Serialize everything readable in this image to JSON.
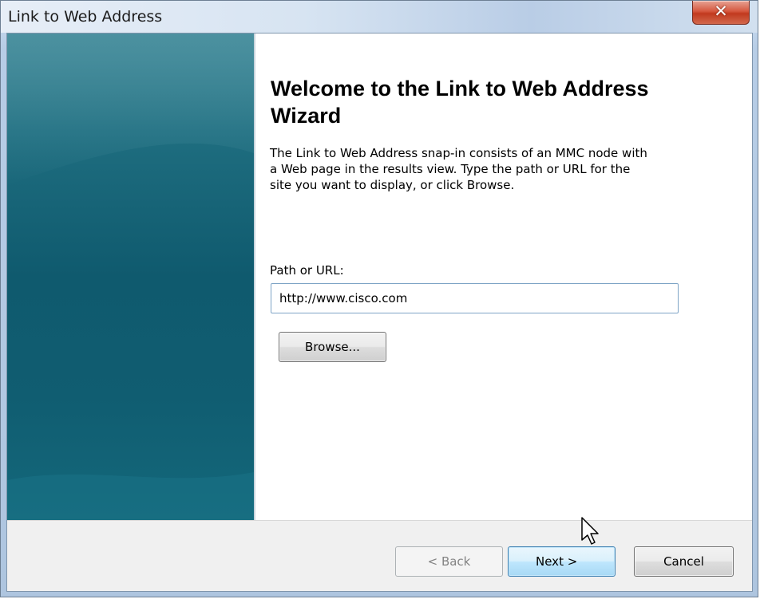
{
  "window": {
    "title": "Link to Web Address"
  },
  "wizard": {
    "heading": "Welcome to the Link to Web Address Wizard",
    "description": "The Link to Web Address snap-in consists of an MMC node with a Web page in the results view. Type the path or URL for the site you want to display, or click Browse.",
    "path_label": "Path or URL:",
    "path_value": "http://www.cisco.com",
    "browse_label": "Browse..."
  },
  "footer": {
    "back_label": "< Back",
    "next_label": "Next >",
    "cancel_label": "Cancel"
  },
  "icons": {
    "close": "close-icon",
    "cursor": "cursor-arrow-icon"
  },
  "colors": {
    "side_panel": "#14687b",
    "close_button": "#c1391e",
    "default_button_border": "#3c7fb1"
  }
}
